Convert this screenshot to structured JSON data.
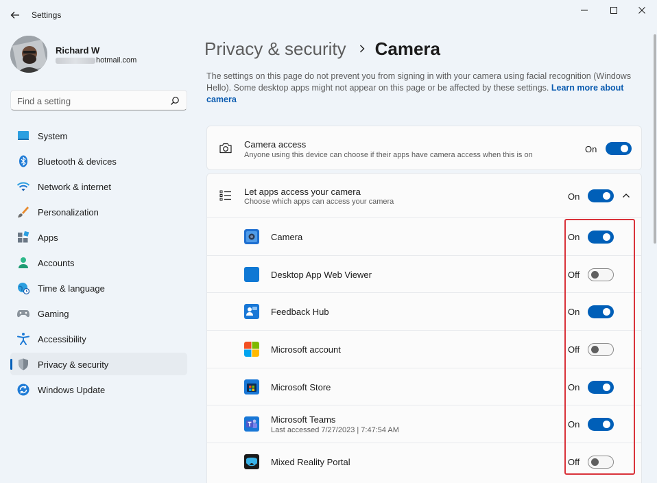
{
  "window": {
    "title": "Settings"
  },
  "profile": {
    "name": "Richard W",
    "email_visible": "hotmail.com"
  },
  "search": {
    "placeholder": "Find a setting"
  },
  "sidebar": {
    "items": [
      {
        "label": "System",
        "icon": "system-icon"
      },
      {
        "label": "Bluetooth & devices",
        "icon": "bluetooth-icon"
      },
      {
        "label": "Network & internet",
        "icon": "wifi-icon"
      },
      {
        "label": "Personalization",
        "icon": "brush-icon"
      },
      {
        "label": "Apps",
        "icon": "apps-icon"
      },
      {
        "label": "Accounts",
        "icon": "person-icon"
      },
      {
        "label": "Time & language",
        "icon": "globe-clock-icon"
      },
      {
        "label": "Gaming",
        "icon": "gamepad-icon"
      },
      {
        "label": "Accessibility",
        "icon": "accessibility-icon"
      },
      {
        "label": "Privacy & security",
        "icon": "shield-icon",
        "active": true
      },
      {
        "label": "Windows Update",
        "icon": "update-icon"
      }
    ]
  },
  "breadcrumb": {
    "parent": "Privacy & security",
    "current": "Camera"
  },
  "description": {
    "text": "The settings on this page do not prevent you from signing in with your camera using facial recognition (Windows Hello). Some desktop apps might not appear on this page or be affected by these settings.",
    "link": "Learn more about camera"
  },
  "camera_access": {
    "title": "Camera access",
    "subtitle": "Anyone using this device can choose if their apps have camera access when this is on",
    "state": "On",
    "on": true
  },
  "app_access": {
    "title": "Let apps access your camera",
    "subtitle": "Choose which apps can access your camera",
    "state": "On",
    "on": true
  },
  "apps": [
    {
      "name": "Camera",
      "state": "On",
      "on": true,
      "icon": "camera-app-icon"
    },
    {
      "name": "Desktop App Web Viewer",
      "state": "Off",
      "on": false,
      "icon": "web-viewer-icon"
    },
    {
      "name": "Feedback Hub",
      "state": "On",
      "on": true,
      "icon": "feedback-hub-icon"
    },
    {
      "name": "Microsoft account",
      "state": "Off",
      "on": false,
      "icon": "microsoft-logo-icon"
    },
    {
      "name": "Microsoft Store",
      "state": "On",
      "on": true,
      "icon": "store-icon"
    },
    {
      "name": "Microsoft Teams",
      "sub": "Last accessed 7/27/2023  |  7:47:54 AM",
      "state": "On",
      "on": true,
      "icon": "teams-icon"
    },
    {
      "name": "Mixed Reality Portal",
      "state": "Off",
      "on": false,
      "icon": "mixed-reality-icon"
    }
  ],
  "colors": {
    "accent": "#005fb8",
    "background": "#eff4f9",
    "card": "#fbfbfb",
    "highlight": "#d9323a"
  }
}
